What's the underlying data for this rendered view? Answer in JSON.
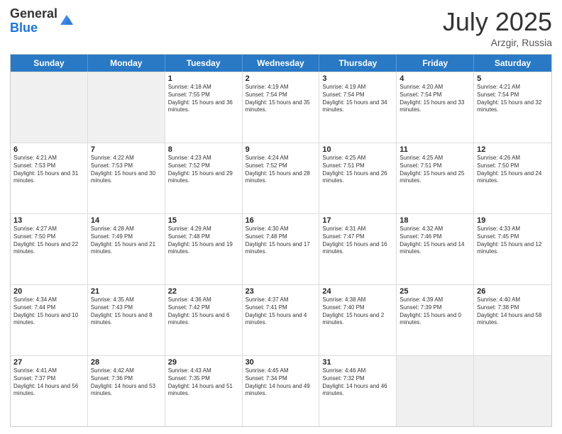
{
  "header": {
    "logo_general": "General",
    "logo_blue": "Blue",
    "month": "July 2025",
    "location": "Arzgir, Russia"
  },
  "days_of_week": [
    "Sunday",
    "Monday",
    "Tuesday",
    "Wednesday",
    "Thursday",
    "Friday",
    "Saturday"
  ],
  "weeks": [
    [
      {
        "day": "",
        "info": "",
        "shaded": true
      },
      {
        "day": "",
        "info": "",
        "shaded": true
      },
      {
        "day": "1",
        "info": "Sunrise: 4:18 AM\nSunset: 7:55 PM\nDaylight: 15 hours and 36 minutes."
      },
      {
        "day": "2",
        "info": "Sunrise: 4:19 AM\nSunset: 7:54 PM\nDaylight: 15 hours and 35 minutes."
      },
      {
        "day": "3",
        "info": "Sunrise: 4:19 AM\nSunset: 7:54 PM\nDaylight: 15 hours and 34 minutes."
      },
      {
        "day": "4",
        "info": "Sunrise: 4:20 AM\nSunset: 7:54 PM\nDaylight: 15 hours and 33 minutes."
      },
      {
        "day": "5",
        "info": "Sunrise: 4:21 AM\nSunset: 7:54 PM\nDaylight: 15 hours and 32 minutes."
      }
    ],
    [
      {
        "day": "6",
        "info": "Sunrise: 4:21 AM\nSunset: 7:53 PM\nDaylight: 15 hours and 31 minutes."
      },
      {
        "day": "7",
        "info": "Sunrise: 4:22 AM\nSunset: 7:53 PM\nDaylight: 15 hours and 30 minutes."
      },
      {
        "day": "8",
        "info": "Sunrise: 4:23 AM\nSunset: 7:52 PM\nDaylight: 15 hours and 29 minutes."
      },
      {
        "day": "9",
        "info": "Sunrise: 4:24 AM\nSunset: 7:52 PM\nDaylight: 15 hours and 28 minutes."
      },
      {
        "day": "10",
        "info": "Sunrise: 4:25 AM\nSunset: 7:51 PM\nDaylight: 15 hours and 26 minutes."
      },
      {
        "day": "11",
        "info": "Sunrise: 4:25 AM\nSunset: 7:51 PM\nDaylight: 15 hours and 25 minutes."
      },
      {
        "day": "12",
        "info": "Sunrise: 4:26 AM\nSunset: 7:50 PM\nDaylight: 15 hours and 24 minutes."
      }
    ],
    [
      {
        "day": "13",
        "info": "Sunrise: 4:27 AM\nSunset: 7:50 PM\nDaylight: 15 hours and 22 minutes."
      },
      {
        "day": "14",
        "info": "Sunrise: 4:28 AM\nSunset: 7:49 PM\nDaylight: 15 hours and 21 minutes."
      },
      {
        "day": "15",
        "info": "Sunrise: 4:29 AM\nSunset: 7:48 PM\nDaylight: 15 hours and 19 minutes."
      },
      {
        "day": "16",
        "info": "Sunrise: 4:30 AM\nSunset: 7:48 PM\nDaylight: 15 hours and 17 minutes."
      },
      {
        "day": "17",
        "info": "Sunrise: 4:31 AM\nSunset: 7:47 PM\nDaylight: 15 hours and 16 minutes."
      },
      {
        "day": "18",
        "info": "Sunrise: 4:32 AM\nSunset: 7:46 PM\nDaylight: 15 hours and 14 minutes."
      },
      {
        "day": "19",
        "info": "Sunrise: 4:33 AM\nSunset: 7:45 PM\nDaylight: 15 hours and 12 minutes."
      }
    ],
    [
      {
        "day": "20",
        "info": "Sunrise: 4:34 AM\nSunset: 7:44 PM\nDaylight: 15 hours and 10 minutes."
      },
      {
        "day": "21",
        "info": "Sunrise: 4:35 AM\nSunset: 7:43 PM\nDaylight: 15 hours and 8 minutes."
      },
      {
        "day": "22",
        "info": "Sunrise: 4:36 AM\nSunset: 7:42 PM\nDaylight: 15 hours and 6 minutes."
      },
      {
        "day": "23",
        "info": "Sunrise: 4:37 AM\nSunset: 7:41 PM\nDaylight: 15 hours and 4 minutes."
      },
      {
        "day": "24",
        "info": "Sunrise: 4:38 AM\nSunset: 7:40 PM\nDaylight: 15 hours and 2 minutes."
      },
      {
        "day": "25",
        "info": "Sunrise: 4:39 AM\nSunset: 7:39 PM\nDaylight: 15 hours and 0 minutes."
      },
      {
        "day": "26",
        "info": "Sunrise: 4:40 AM\nSunset: 7:38 PM\nDaylight: 14 hours and 58 minutes."
      }
    ],
    [
      {
        "day": "27",
        "info": "Sunrise: 4:41 AM\nSunset: 7:37 PM\nDaylight: 14 hours and 56 minutes."
      },
      {
        "day": "28",
        "info": "Sunrise: 4:42 AM\nSunset: 7:36 PM\nDaylight: 14 hours and 53 minutes."
      },
      {
        "day": "29",
        "info": "Sunrise: 4:43 AM\nSunset: 7:35 PM\nDaylight: 14 hours and 51 minutes."
      },
      {
        "day": "30",
        "info": "Sunrise: 4:45 AM\nSunset: 7:34 PM\nDaylight: 14 hours and 49 minutes."
      },
      {
        "day": "31",
        "info": "Sunrise: 4:46 AM\nSunset: 7:32 PM\nDaylight: 14 hours and 46 minutes."
      },
      {
        "day": "",
        "info": "",
        "shaded": true
      },
      {
        "day": "",
        "info": "",
        "shaded": true
      }
    ]
  ]
}
